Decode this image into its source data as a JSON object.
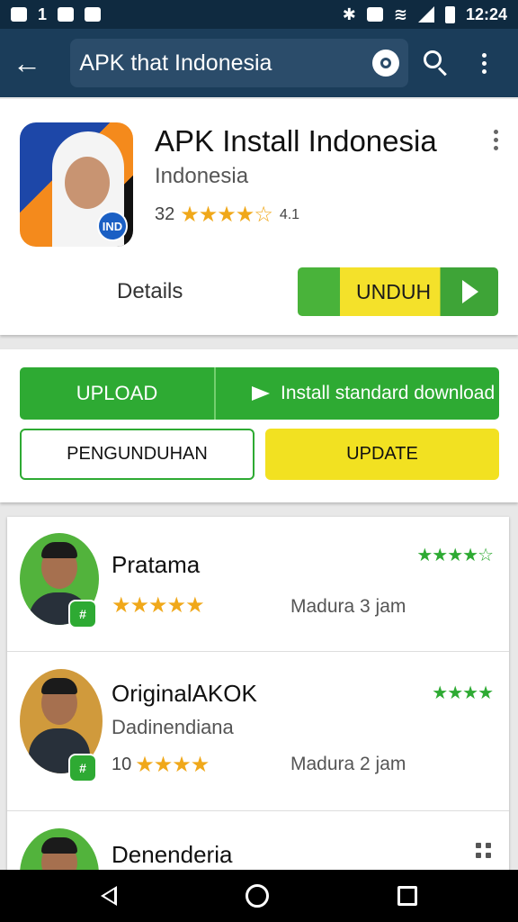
{
  "status_bar": {
    "left_glyph": "1",
    "time": "12:24"
  },
  "toolbar": {
    "search_query": "APK that Indonesia"
  },
  "app": {
    "title": "APK Install Indonesia",
    "subtitle": "Indonesia",
    "rating_count": "32",
    "stars": "★★★★☆",
    "rating_suffix": "4.1",
    "icon_badge": "IND",
    "details_label": "Details",
    "install_label": "UNDUH"
  },
  "actions": {
    "primary_left": "UPLOAD",
    "primary_right": "Install standard download",
    "secondary_left": "PENGUNDUHAN",
    "secondary_right": "UPDATE"
  },
  "list": [
    {
      "name": "Pratama",
      "subtitle": "",
      "count": "",
      "stars": "★★★★★",
      "meta": "Madura 3 jam",
      "rating": "★★★★☆",
      "badge": "#"
    },
    {
      "name": "OriginalAKOK",
      "subtitle": "Dadinendiana",
      "count": "10",
      "stars": "★★★★",
      "meta": "Madura 2 jam",
      "rating": "★★★★",
      "badge": "#"
    },
    {
      "name": "Denenderia",
      "subtitle": "",
      "count": "",
      "stars": "",
      "meta": "",
      "rating": "",
      "badge": ""
    }
  ],
  "colors": {
    "toolbar": "#1b3d5a",
    "green": "#2eaa33",
    "yellow": "#f2e121",
    "star": "#f0a81a"
  }
}
